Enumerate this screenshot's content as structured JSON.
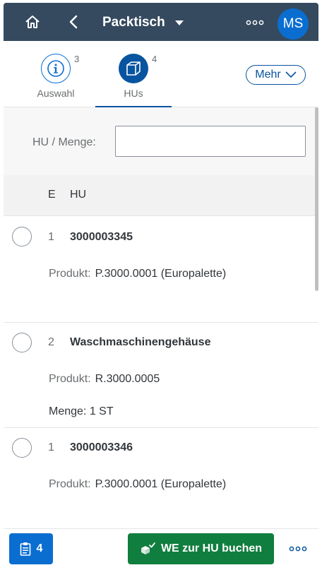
{
  "shell": {
    "title": "Packtisch",
    "avatar_initials": "MS",
    "icons": [
      "home-icon",
      "back-icon",
      "overflow-icon"
    ]
  },
  "tabs": [
    {
      "label": "Auswahl",
      "count": "3",
      "icon": "info-icon"
    },
    {
      "label": "HUs",
      "count": "4",
      "icon": "box-icon"
    }
  ],
  "mehr_label": "Mehr",
  "filter": {
    "label": "HU / Menge:",
    "value": ""
  },
  "table": {
    "columns": [
      "E",
      "HU"
    ],
    "rows": [
      {
        "e": "1",
        "hu": "3000003345",
        "produkt_label": "Produkt:",
        "produkt": "P.3000.0001 (Europalette)"
      },
      {
        "e": "2",
        "hu": "Waschmaschinengehäuse",
        "produkt_label": "Produkt:",
        "produkt": "R.3000.0005",
        "menge": "Menge: 1 ST"
      },
      {
        "e": "1",
        "hu": "3000003346",
        "produkt_label": "Produkt:",
        "produkt": "P.3000.0001 (Europalette)"
      }
    ]
  },
  "footer": {
    "count_label": "4",
    "book_label": "WE zur HU buchen"
  },
  "colors": {
    "shell": "#354a5f",
    "brand": "#0a6ed1",
    "accept": "#107e3e"
  }
}
